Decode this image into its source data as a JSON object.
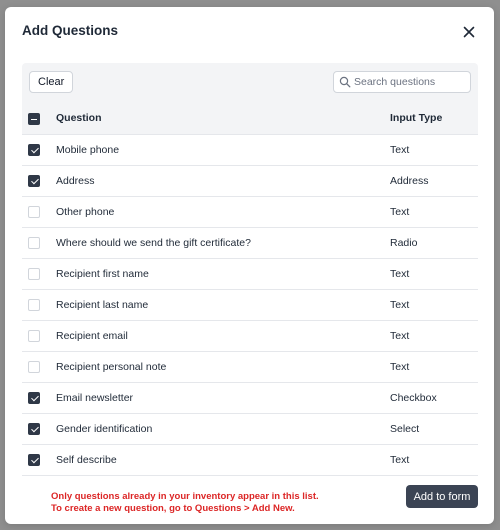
{
  "modal": {
    "title": "Add Questions",
    "clear_label": "Clear",
    "search_placeholder": "Search questions",
    "search_value": "",
    "add_button_label": "Add to form",
    "footer_line1": "Only questions already in your inventory appear in this list.",
    "footer_line2": "To create a new question, go to Questions > Add New."
  },
  "table": {
    "headers": {
      "question": "Question",
      "input_type": "Input Type"
    },
    "select_all_state": "indeterminate",
    "rows": [
      {
        "question": "Mobile phone",
        "input_type": "Text",
        "checked": true
      },
      {
        "question": "Address",
        "input_type": "Address",
        "checked": true
      },
      {
        "question": "Other phone",
        "input_type": "Text",
        "checked": false
      },
      {
        "question": "Where should we send the gift certificate?",
        "input_type": "Radio",
        "checked": false
      },
      {
        "question": "Recipient first name",
        "input_type": "Text",
        "checked": false
      },
      {
        "question": "Recipient last name",
        "input_type": "Text",
        "checked": false
      },
      {
        "question": "Recipient email",
        "input_type": "Text",
        "checked": false
      },
      {
        "question": "Recipient personal note",
        "input_type": "Text",
        "checked": false
      },
      {
        "question": "Email newsletter",
        "input_type": "Checkbox",
        "checked": true
      },
      {
        "question": "Gender identification",
        "input_type": "Select",
        "checked": true
      },
      {
        "question": "Self describe",
        "input_type": "Text",
        "checked": true
      }
    ]
  },
  "icons": {
    "close": "close-icon",
    "search": "search-icon"
  },
  "colors": {
    "checkbox_checked": "#2f3847",
    "primary_button": "#3b4454",
    "note_text": "#dc2626"
  }
}
